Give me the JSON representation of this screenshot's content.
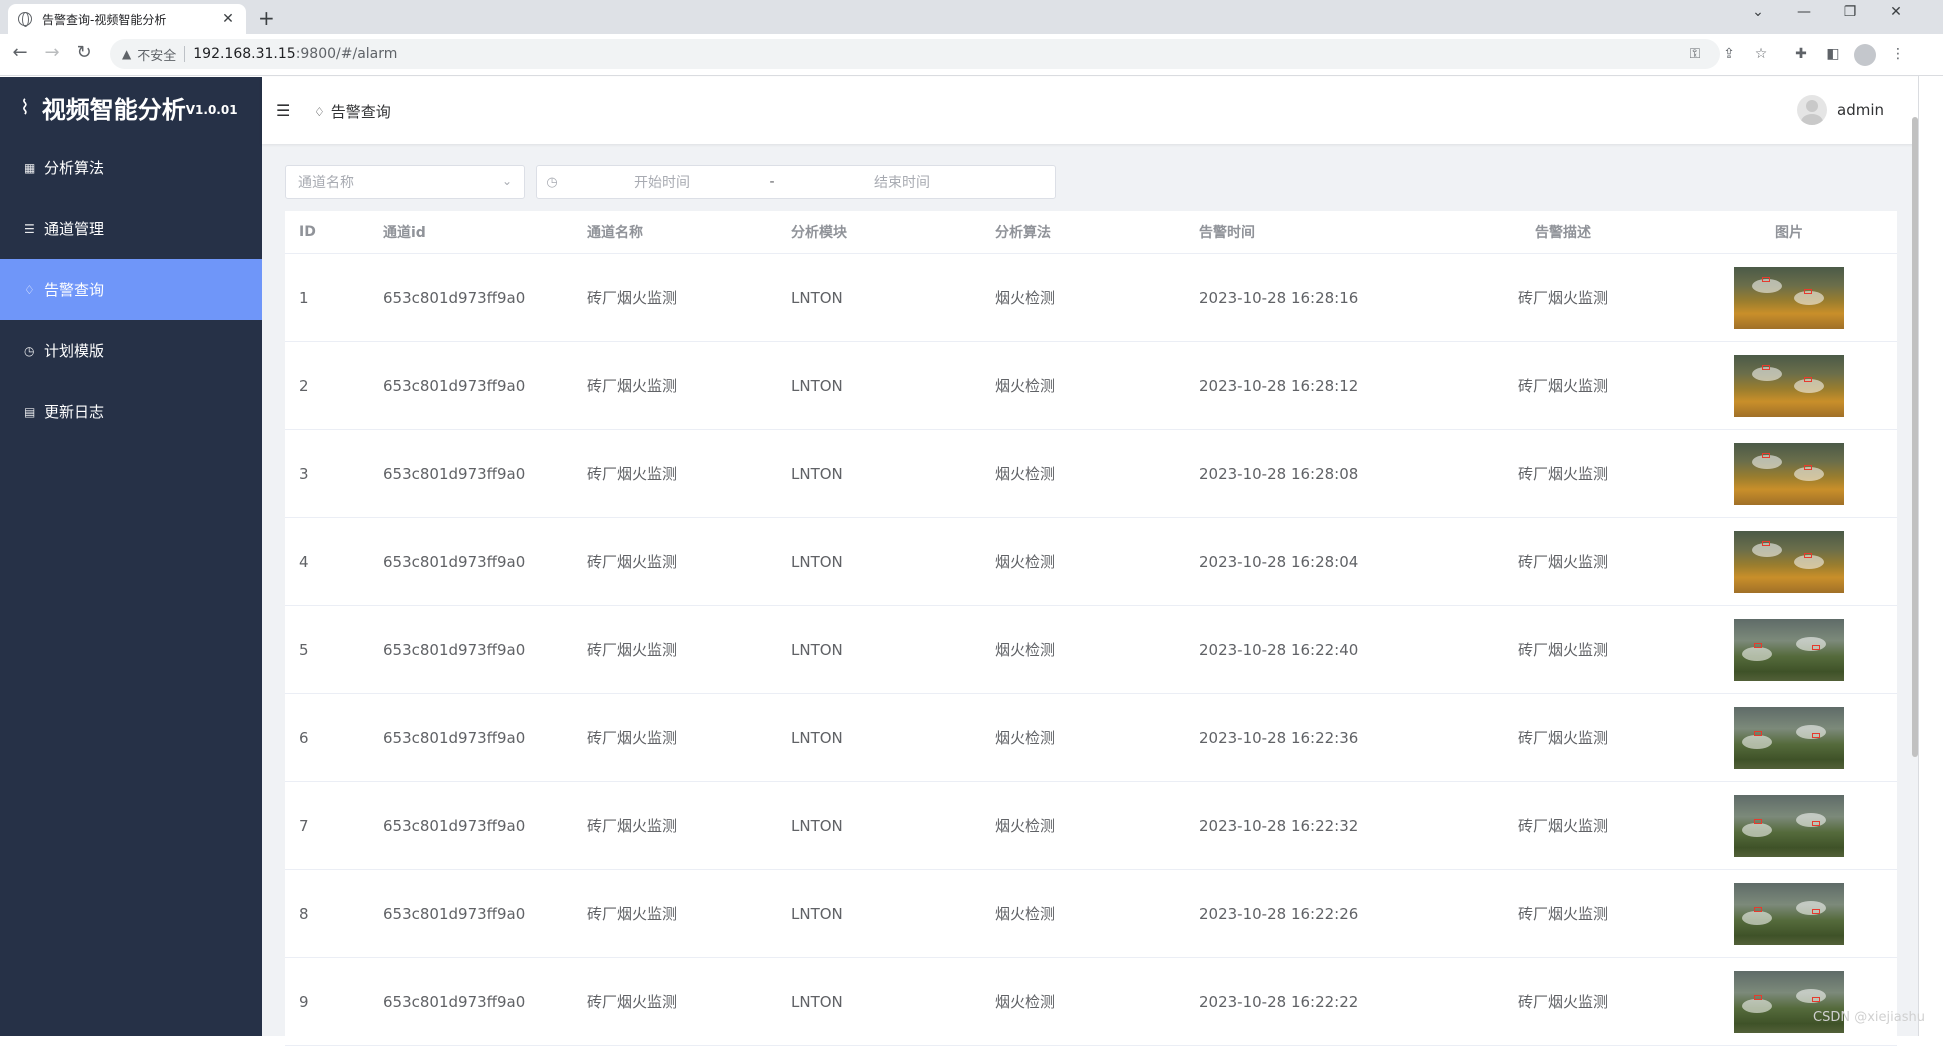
{
  "browser": {
    "tab_title": "告警查询-视频智能分析",
    "tab_close": "✕",
    "new_tab": "+",
    "window_controls": [
      "⌄",
      "—",
      "❐",
      "✕"
    ],
    "insecure_label": "不安全",
    "url_host": "192.168.31.15",
    "url_rest": ":9800/#/alarm"
  },
  "app": {
    "brand_name": "视频智能分析",
    "brand_version": "V1.0.01",
    "menu": [
      {
        "label": "分析算法",
        "icon": "grid-icon",
        "active": false
      },
      {
        "label": "通道管理",
        "icon": "list-icon",
        "active": false
      },
      {
        "label": "告警查询",
        "icon": "bell-icon",
        "active": true
      },
      {
        "label": "计划模版",
        "icon": "clock-icon",
        "active": false
      },
      {
        "label": "更新日志",
        "icon": "document-icon",
        "active": false
      }
    ],
    "breadcrumb": "告警查询",
    "user_name": "admin"
  },
  "filters": {
    "channel_placeholder": "通道名称",
    "start_placeholder": "开始时间",
    "range_separator": "-",
    "end_placeholder": "结束时间"
  },
  "table": {
    "headers": [
      "ID",
      "通道id",
      "通道名称",
      "分析模块",
      "分析算法",
      "告警时间",
      "告警描述",
      "图片"
    ],
    "rows": [
      {
        "id": "1",
        "channel_id": "653c801d973ff9a0",
        "channel_name": "砖厂烟火监测",
        "module": "LNTON",
        "algorithm": "烟火检测",
        "time": "2023-10-28 16:28:16",
        "desc": "砖厂烟火监测",
        "thumb": "t1"
      },
      {
        "id": "2",
        "channel_id": "653c801d973ff9a0",
        "channel_name": "砖厂烟火监测",
        "module": "LNTON",
        "algorithm": "烟火检测",
        "time": "2023-10-28 16:28:12",
        "desc": "砖厂烟火监测",
        "thumb": "t1"
      },
      {
        "id": "3",
        "channel_id": "653c801d973ff9a0",
        "channel_name": "砖厂烟火监测",
        "module": "LNTON",
        "algorithm": "烟火检测",
        "time": "2023-10-28 16:28:08",
        "desc": "砖厂烟火监测",
        "thumb": "t1"
      },
      {
        "id": "4",
        "channel_id": "653c801d973ff9a0",
        "channel_name": "砖厂烟火监测",
        "module": "LNTON",
        "algorithm": "烟火检测",
        "time": "2023-10-28 16:28:04",
        "desc": "砖厂烟火监测",
        "thumb": "t1"
      },
      {
        "id": "5",
        "channel_id": "653c801d973ff9a0",
        "channel_name": "砖厂烟火监测",
        "module": "LNTON",
        "algorithm": "烟火检测",
        "time": "2023-10-28 16:22:40",
        "desc": "砖厂烟火监测",
        "thumb": "t2"
      },
      {
        "id": "6",
        "channel_id": "653c801d973ff9a0",
        "channel_name": "砖厂烟火监测",
        "module": "LNTON",
        "algorithm": "烟火检测",
        "time": "2023-10-28 16:22:36",
        "desc": "砖厂烟火监测",
        "thumb": "t2"
      },
      {
        "id": "7",
        "channel_id": "653c801d973ff9a0",
        "channel_name": "砖厂烟火监测",
        "module": "LNTON",
        "algorithm": "烟火检测",
        "time": "2023-10-28 16:22:32",
        "desc": "砖厂烟火监测",
        "thumb": "t2"
      },
      {
        "id": "8",
        "channel_id": "653c801d973ff9a0",
        "channel_name": "砖厂烟火监测",
        "module": "LNTON",
        "algorithm": "烟火检测",
        "time": "2023-10-28 16:22:26",
        "desc": "砖厂烟火监测",
        "thumb": "t2"
      },
      {
        "id": "9",
        "channel_id": "653c801d973ff9a0",
        "channel_name": "砖厂烟火监测",
        "module": "LNTON",
        "algorithm": "烟火检测",
        "time": "2023-10-28 16:22:22",
        "desc": "砖厂烟火监测",
        "thumb": "t2"
      }
    ]
  },
  "watermark": "CSDN @xiejiashu",
  "colors": {
    "sidebar_bg": "#263147",
    "active_menu": "#6f96f9",
    "main_bg": "#f0f2f5"
  }
}
